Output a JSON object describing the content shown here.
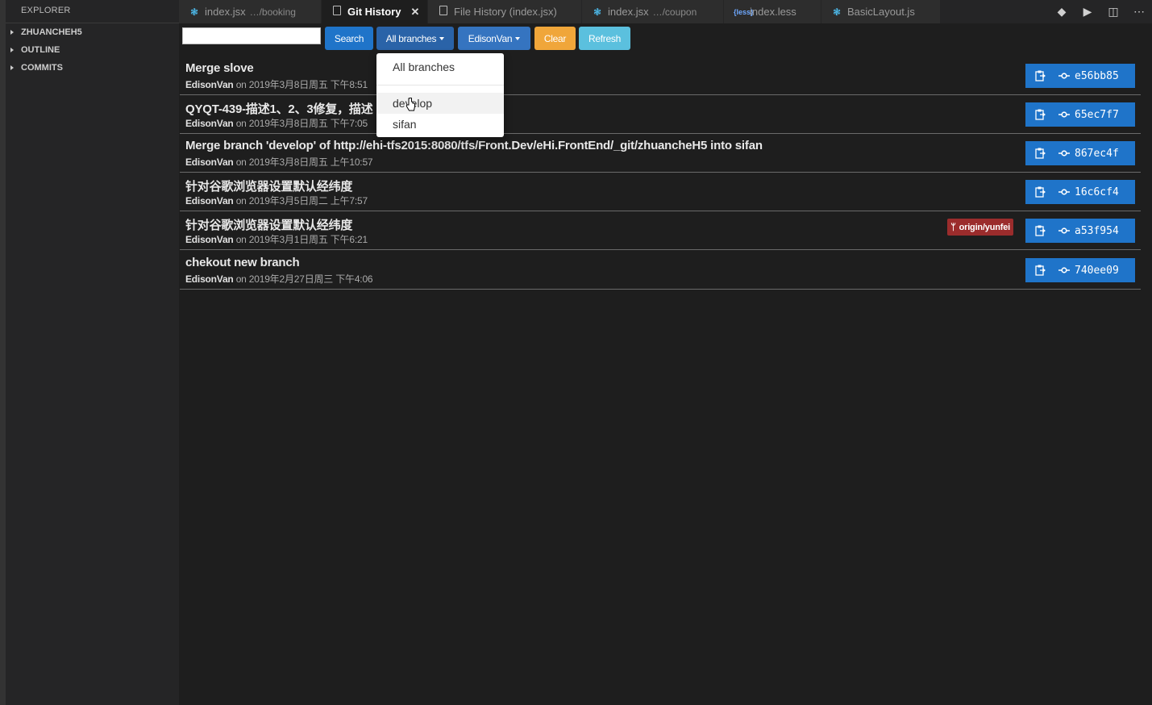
{
  "sidebar": {
    "title": "EXPLORER",
    "sections": [
      {
        "label": "ZHUANCHEH5"
      },
      {
        "label": "OUTLINE"
      },
      {
        "label": "COMMITS"
      }
    ]
  },
  "tabs": [
    {
      "label": "index.jsx",
      "desc": "…/booking",
      "icon": "react-icon"
    },
    {
      "label": "Git History",
      "desc": "",
      "icon": "file-icon",
      "active": true
    },
    {
      "label": "File History (index.jsx)",
      "desc": "",
      "icon": "file-icon"
    },
    {
      "label": "index.jsx",
      "desc": "…/coupon",
      "icon": "react-icon"
    },
    {
      "label": "index.less",
      "desc": "",
      "icon": "less-icon"
    },
    {
      "label": "BasicLayout.js",
      "desc": "",
      "icon": "react-icon"
    }
  ],
  "tab_actions": [
    "git-compare-icon",
    "run-icon",
    "split-editor-icon",
    "more-icon"
  ],
  "toolbar": {
    "search_value": "",
    "search_label": "Search",
    "branch_label": "All branches",
    "author_label": "EdisonVan",
    "clear_label": "Clear",
    "refresh_label": "Refresh"
  },
  "branch_dropdown": {
    "items": [
      "All branches",
      "develop",
      "sifan"
    ],
    "hovered": "develop"
  },
  "commits": [
    {
      "message": "Merge slove",
      "author": "EdisonVan",
      "date_text": "on 2019年3月8日周五 下午8:51",
      "hash": "e56bb85",
      "branch": ""
    },
    {
      "message": "QYQT-439-描述1、2、3修复，描述",
      "author": "EdisonVan",
      "date_text": "on 2019年3月8日周五 下午7:05",
      "hash": "65ec7f7",
      "branch": ""
    },
    {
      "message": "Merge branch 'develop' of http://ehi-tfs2015:8080/tfs/Front.Dev/eHi.FrontEnd/_git/zhuancheH5 into sifan",
      "author": "EdisonVan",
      "date_text": "on 2019年3月8日周五 上午10:57",
      "hash": "867ec4f",
      "branch": ""
    },
    {
      "message": "针对谷歌浏览器设置默认经纬度",
      "author": "EdisonVan",
      "date_text": "on 2019年3月5日周二 上午7:57",
      "hash": "16c6cf4",
      "branch": ""
    },
    {
      "message": "针对谷歌浏览器设置默认经纬度",
      "author": "EdisonVan",
      "date_text": "on 2019年3月1日周五 下午6:21",
      "hash": "a53f954",
      "branch": "origin/yunfei"
    },
    {
      "message": "chekout new branch",
      "author": "EdisonVan",
      "date_text": "on 2019年2月27日周三 下午4:06",
      "hash": "740ee09",
      "branch": ""
    }
  ],
  "colors": {
    "search_btn": "#1f74c9",
    "branch_btn": "#2a63a8",
    "author_btn": "#3574c0",
    "clear_btn": "#f0a63a",
    "refresh_btn": "#5bc0de",
    "hash_btn": "#1f74c9",
    "branch_tag": "#9b2c2c"
  }
}
